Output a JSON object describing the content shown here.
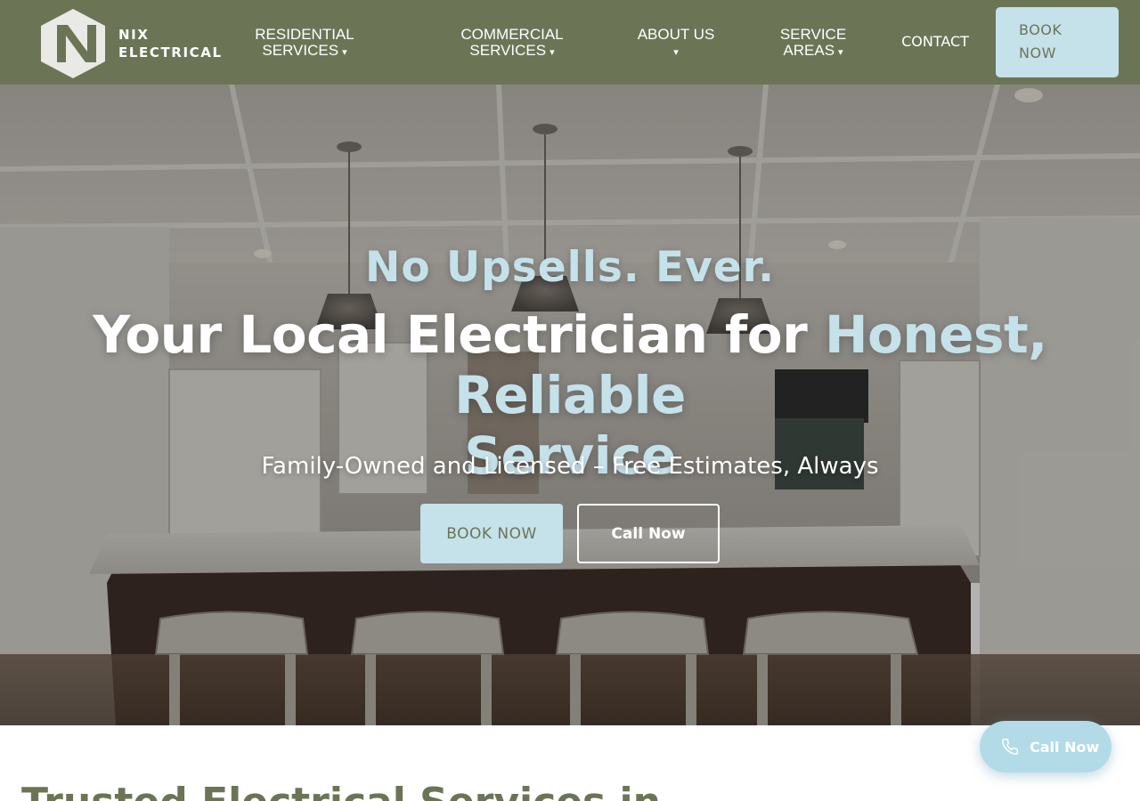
{
  "header": {
    "logo_line1": "NIX",
    "logo_line2": "ELECTRICAL",
    "nav": {
      "residential_line1": "RESIDENTIAL",
      "residential_line2": "SERVICES",
      "commercial_line1": "COMMERCIAL",
      "commercial_line2": "SERVICES",
      "about": "ABOUT US",
      "areas_line1": "SERVICE",
      "areas_line2": "AREAS",
      "contact": "CONTACT",
      "caret": "▾"
    },
    "book_line1": "BOOK",
    "book_line2": "NOW"
  },
  "hero": {
    "eyebrow": "No Upsells. Ever.",
    "title_plain": "Your Local Electrician for",
    "title_accent_1": "Honest, Reliable",
    "title_accent_2": "Service",
    "subtitle": "Family-Owned and Licensed – Free Estimates, Always",
    "book_button": "BOOK NOW",
    "call_button": "Call Now"
  },
  "section": {
    "heading": "Trusted Electrical Services in"
  },
  "floating": {
    "call_label": "Call Now",
    "icon": "phone-icon"
  },
  "colors": {
    "brand_green": "#6b7556",
    "accent_blue": "#c5e1ea",
    "float_blue": "#b3dbe7"
  }
}
